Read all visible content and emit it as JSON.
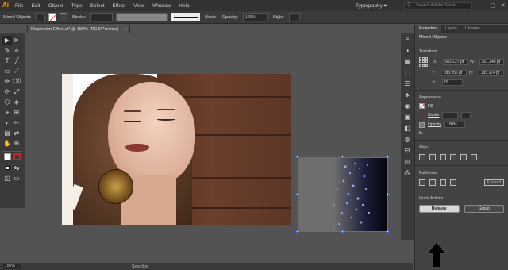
{
  "app": {
    "logo": "Ai"
  },
  "menu": [
    "File",
    "Edit",
    "Object",
    "Type",
    "Select",
    "Effect",
    "View",
    "Window",
    "Help"
  ],
  "workspace": {
    "label": "Typography ▾",
    "stock_placeholder": "Search Adobe Stock"
  },
  "window_controls": [
    "—",
    "▢",
    "✕"
  ],
  "control_bar": {
    "selection": "Mixed Objects",
    "stroke_label": "Stroke:",
    "brush": "Basic",
    "opacity_label": "Opacity:",
    "opacity_value": "100%",
    "style_label": "Style:"
  },
  "document": {
    "tab_title": "Dispersion Effect.ai* @ 150% (RGB/Preview)",
    "close": "×"
  },
  "tools": [
    "▶",
    "⊳",
    "✎",
    "⟡",
    "T",
    "╱",
    "▭",
    "⟋",
    "✏",
    "⌫",
    "⟳",
    "⤢",
    "⬡",
    "◈",
    "⌖",
    "⊞",
    "◐",
    "✂",
    "▤",
    "⇄",
    "✋",
    "⊕"
  ],
  "dock_icons": [
    "≡",
    "◑",
    "▦",
    "⬚",
    "☰",
    "♣",
    "◉",
    "▣",
    "◧",
    "◍",
    "⊟",
    "◎",
    "⁂"
  ],
  "statusbar": {
    "zoom": "150%",
    "tool": "Selection"
  },
  "panel": {
    "tabs": [
      "Properties",
      "Layers",
      "Libraries"
    ],
    "selection_type": "Mixed Objects",
    "transform": {
      "title": "Transform",
      "x_label": "X:",
      "x_value": "583.127 pt",
      "w_label": "W:",
      "w_value": "161.246 pt",
      "y_label": "Y:",
      "y_value": "283.956 pt",
      "h_label": "H:",
      "h_value": "135.174 pt",
      "rotate_value": "0°"
    },
    "appearance": {
      "title": "Appearance",
      "fill_label": "Fill",
      "stroke_label": "Stroke",
      "opacity_label": "Opacity",
      "opacity_value": "100%",
      "fx": "fx."
    },
    "align": {
      "title": "Align"
    },
    "pathfinder": {
      "title": "Pathfinder",
      "expand_label": "Expand"
    },
    "quick_actions": {
      "title": "Quick Actions",
      "release_label": "Release",
      "group_label": "Group"
    }
  }
}
